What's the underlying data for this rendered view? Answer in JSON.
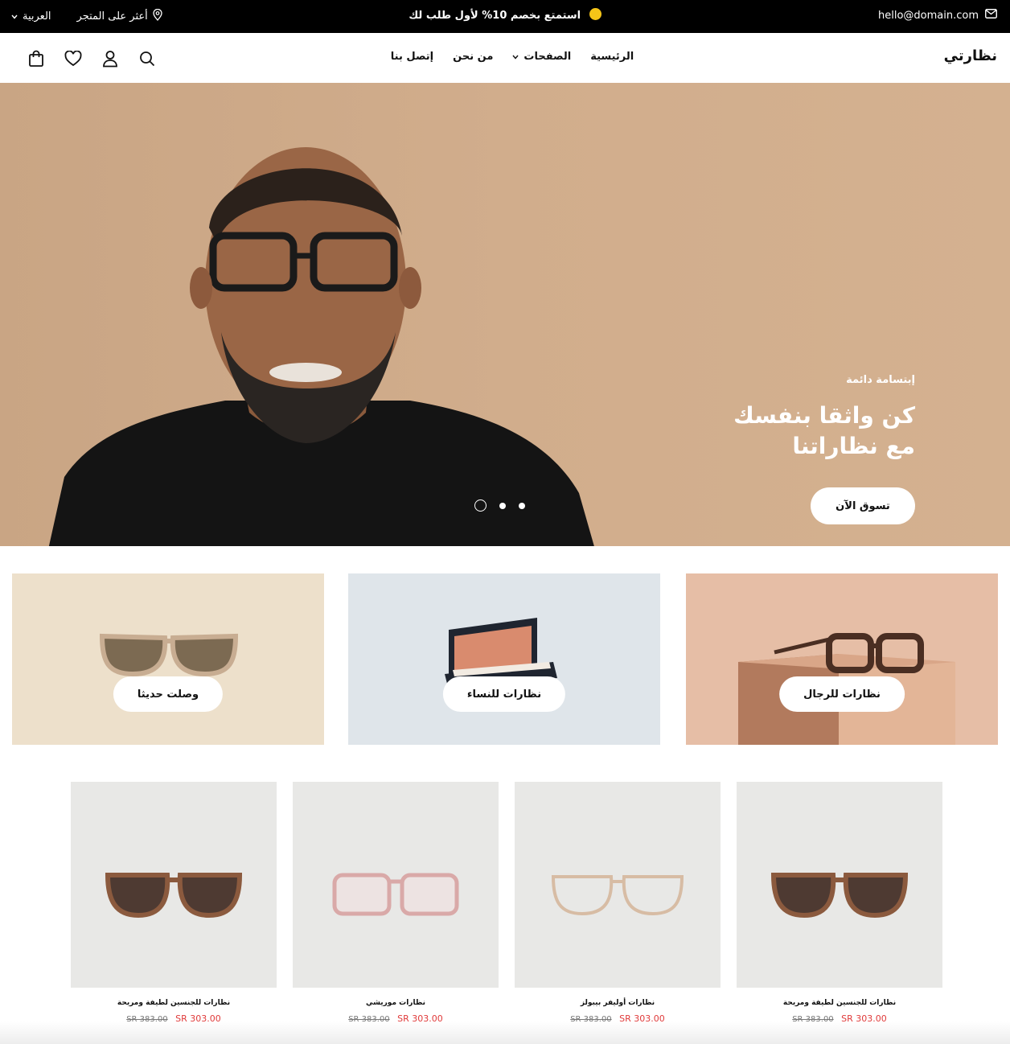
{
  "topbar": {
    "email": "hello@domain.com",
    "promo": "استمتع بخصم 10% لأول طلب لك",
    "store_finder": "أعثر على المتجر",
    "language": "العربية"
  },
  "header": {
    "logo": "نظارتي",
    "nav": [
      {
        "label": "الرئيسية"
      },
      {
        "label": "الصفحات"
      },
      {
        "label": "من نحن"
      },
      {
        "label": "إتصل بنا"
      }
    ],
    "icons": [
      "search-icon",
      "account-icon",
      "heart-icon",
      "bag-icon"
    ]
  },
  "hero": {
    "eyebrow": "إبتسامة دائمة",
    "title": "كن واثقا بنفسك مع نظاراتنا",
    "cta": "تسوق الآن",
    "slide_count": 3,
    "active_slide": 3
  },
  "categories": [
    {
      "label": "نظارات للرجال",
      "bg": "#e6bea6"
    },
    {
      "label": "نظارات للنساء",
      "bg": "#dfe5ea"
    },
    {
      "label": "وصلت حديثا",
      "bg": "#ede0cb"
    }
  ],
  "products": [
    {
      "name": "نظارات للجنسين لطيفة ومريحة",
      "old_price": "SR 383.00",
      "price": "SR 303.00"
    },
    {
      "name": "نظارات أوليفر بيبولز",
      "old_price": "SR 383.00",
      "price": "SR 303.00"
    },
    {
      "name": "نظارات موريشي",
      "old_price": "SR 383.00",
      "price": "SR 303.00"
    },
    {
      "name": "نظارات للجنسين لطيفة ومريحة",
      "old_price": "SR 383.00",
      "price": "SR 303.00"
    }
  ],
  "colors": {
    "topbar": "#000000",
    "sale_price": "#e03a3a",
    "hero_bg": "#d1ad8c"
  }
}
